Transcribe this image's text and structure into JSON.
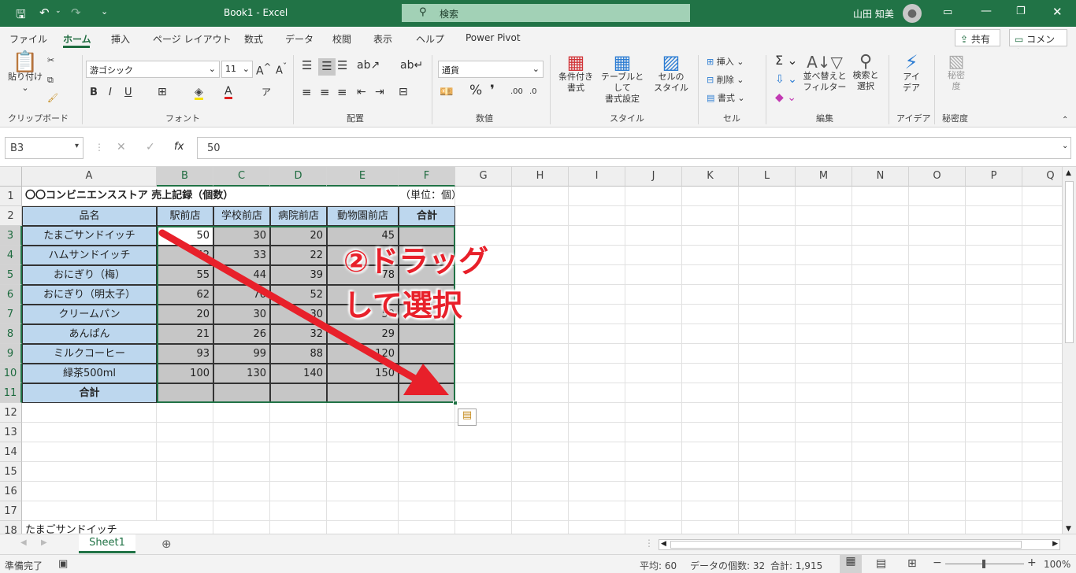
{
  "titlebar": {
    "doc_title": "Book1  -  Excel",
    "search_placeholder": "検索",
    "user_name": "山田 知美"
  },
  "ribbon_tabs": [
    "ファイル",
    "ホーム",
    "挿入",
    "ページ レイアウト",
    "数式",
    "データ",
    "校閲",
    "表示",
    "ヘルプ",
    "Power Pivot"
  ],
  "share_label": "共有",
  "comment_label": "コメント",
  "ribbon": {
    "paste_label": "貼り付け",
    "font_name": "游ゴシック",
    "font_size": "11",
    "number_format": "通貨",
    "cond_format": "条件付き\n書式",
    "table_format": "テーブルとして\n書式設定",
    "cell_style": "セルの\nスタイル",
    "insert": "挿入",
    "delete": "削除",
    "format": "書式",
    "sort_filter": "並べ替えと\nフィルター",
    "find_select": "検索と\n選択",
    "ideas": "アイ\nデア",
    "sensitivity": "秘密\n度",
    "groups": [
      "クリップボード",
      "フォント",
      "配置",
      "数値",
      "スタイル",
      "セル",
      "編集",
      "アイデア",
      "秘密度"
    ]
  },
  "formula_bar": {
    "name_box": "B3",
    "formula": "50",
    "fx": "fx"
  },
  "columns": [
    "A",
    "B",
    "C",
    "D",
    "E",
    "F",
    "G",
    "H",
    "I",
    "J",
    "K",
    "L",
    "M",
    "N",
    "O",
    "P",
    "Q"
  ],
  "rows": [
    "1",
    "2",
    "3",
    "4",
    "5",
    "6",
    "7",
    "8",
    "9",
    "10",
    "11",
    "12",
    "13",
    "14",
    "15",
    "16",
    "17",
    "18"
  ],
  "sheet": {
    "title": "〇〇コンビニエンスストア 売上記録（個数）",
    "unit": "（単位：個）",
    "header_item": "品名",
    "stores": [
      "駅前店",
      "学校前店",
      "病院前店",
      "動物園前店"
    ],
    "total_label": "合計",
    "items": [
      {
        "name": "たまごサンドイッチ",
        "values": [
          "50",
          "30",
          "20",
          "45"
        ]
      },
      {
        "name": "ハムサンドイッチ",
        "values": [
          "42",
          "33",
          "22",
          ""
        ]
      },
      {
        "name": "おにぎり（梅）",
        "values": [
          "55",
          "44",
          "39",
          "78"
        ]
      },
      {
        "name": "おにぎり（明太子）",
        "values": [
          "62",
          "70",
          "52",
          ""
        ]
      },
      {
        "name": "クリームパン",
        "values": [
          "20",
          "30",
          "30",
          "59"
        ]
      },
      {
        "name": "あんぱん",
        "values": [
          "21",
          "26",
          "32",
          "29"
        ]
      },
      {
        "name": "ミルクコーヒー",
        "values": [
          "93",
          "99",
          "88",
          "120"
        ]
      },
      {
        "name": "緑茶500ml",
        "values": [
          "100",
          "130",
          "140",
          "150"
        ]
      }
    ],
    "row18_text": "たまごサンドイッチ"
  },
  "annotation": {
    "line1": "②ドラッグ",
    "line2": "して選択",
    "color": "#e8202a"
  },
  "sheet_tab": "Sheet1",
  "status": {
    "ready": "準備完了",
    "average": "平均: 60",
    "count": "データの個数: 32",
    "sum": "合計: 1,915",
    "zoom": "100%"
  }
}
